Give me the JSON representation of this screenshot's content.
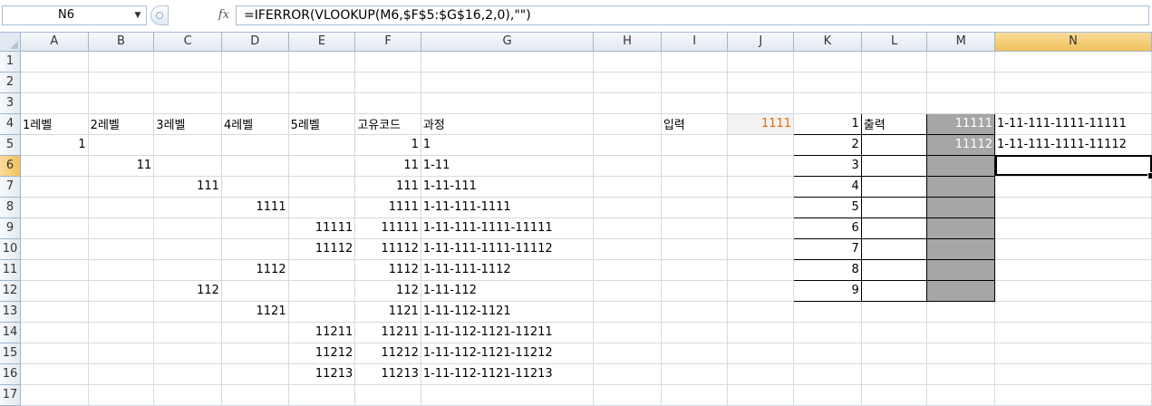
{
  "formula_bar": {
    "name_box": "N6",
    "fx_label": "fx",
    "formula": "=IFERROR(VLOOKUP(M6,$F$5:$G$16,2,0),\"\")"
  },
  "columns": [
    "A",
    "B",
    "C",
    "D",
    "E",
    "F",
    "G",
    "H",
    "I",
    "J",
    "K",
    "L",
    "M",
    "N"
  ],
  "rows": [
    "1",
    "2",
    "3",
    "4",
    "5",
    "6",
    "7",
    "8",
    "9",
    "10",
    "11",
    "12",
    "13",
    "14",
    "15",
    "16",
    "17"
  ],
  "headers": {
    "A4": "1레벨",
    "B4": "2레벨",
    "C4": "3레벨",
    "D4": "4레벨",
    "E4": "5레벨",
    "F4": "고유코드",
    "G4": "과정",
    "I4": "입력",
    "L4": "출력"
  },
  "input_value": "1111",
  "table": [
    {
      "a": "1",
      "b": "",
      "c": "",
      "d": "",
      "e": "",
      "f": "1",
      "g": "1"
    },
    {
      "a": "",
      "b": "11",
      "c": "",
      "d": "",
      "e": "",
      "f": "11",
      "g": "1-11"
    },
    {
      "a": "",
      "b": "",
      "c": "111",
      "d": "",
      "e": "",
      "f": "111",
      "g": "1-11-111"
    },
    {
      "a": "",
      "b": "",
      "c": "",
      "d": "1111",
      "e": "",
      "f": "1111",
      "g": "1-11-111-1111"
    },
    {
      "a": "",
      "b": "",
      "c": "",
      "d": "",
      "e": "11111",
      "f": "11111",
      "g": "1-11-111-1111-11111"
    },
    {
      "a": "",
      "b": "",
      "c": "",
      "d": "",
      "e": "11112",
      "f": "11112",
      "g": "1-11-111-1111-11112"
    },
    {
      "a": "",
      "b": "",
      "c": "",
      "d": "1112",
      "e": "",
      "f": "1112",
      "g": "1-11-111-1112"
    },
    {
      "a": "",
      "b": "",
      "c": "112",
      "d": "",
      "e": "",
      "f": "112",
      "g": "1-11-112"
    },
    {
      "a": "",
      "b": "",
      "c": "",
      "d": "1121",
      "e": "",
      "f": "1121",
      "g": "1-11-112-1121"
    },
    {
      "a": "",
      "b": "",
      "c": "",
      "d": "",
      "e": "11211",
      "f": "11211",
      "g": "1-11-112-1121-11211"
    },
    {
      "a": "",
      "b": "",
      "c": "",
      "d": "",
      "e": "11212",
      "f": "11212",
      "g": "1-11-112-1121-11212"
    },
    {
      "a": "",
      "b": "",
      "c": "",
      "d": "",
      "e": "11213",
      "f": "11213",
      "g": "1-11-112-1121-11213"
    }
  ],
  "output": {
    "k": [
      "1",
      "2",
      "3",
      "4",
      "5",
      "6",
      "7",
      "8",
      "9"
    ],
    "m": [
      "11111",
      "11112",
      "",
      "",
      "",
      "",
      "",
      "",
      ""
    ],
    "n": [
      "1-11-111-1111-11111",
      "1-11-111-1111-11112",
      "",
      "",
      "",
      "",
      "",
      "",
      ""
    ]
  }
}
